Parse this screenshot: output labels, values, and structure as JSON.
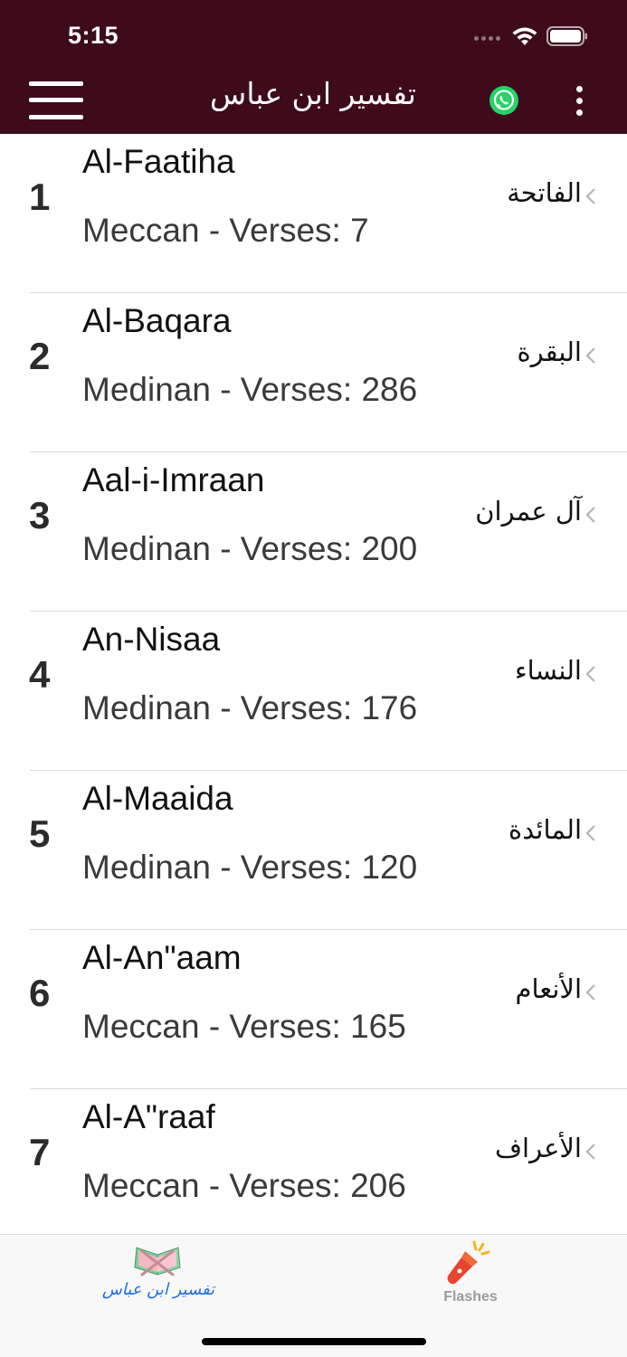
{
  "status_bar": {
    "time": "5:15"
  },
  "nav": {
    "title": "تفسیر ابن عباس"
  },
  "surahs": [
    {
      "number": "1",
      "name": "Al-Faatiha",
      "info": "Meccan - Verses: 7",
      "arabic": "الفاتحة"
    },
    {
      "number": "2",
      "name": "Al-Baqara",
      "info": "Medinan - Verses: 286",
      "arabic": "البقرة"
    },
    {
      "number": "3",
      "name": "Aal-i-Imraan",
      "info": "Medinan - Verses: 200",
      "arabic": "آل عمران"
    },
    {
      "number": "4",
      "name": "An-Nisaa",
      "info": "Medinan - Verses: 176",
      "arabic": "النساء"
    },
    {
      "number": "5",
      "name": "Al-Maaida",
      "info": "Medinan - Verses: 120",
      "arabic": "المائدة"
    },
    {
      "number": "6",
      "name": "Al-An\"aam",
      "info": "Meccan - Verses: 165",
      "arabic": "الأنعام"
    },
    {
      "number": "7",
      "name": "Al-A\"raaf",
      "info": "Meccan - Verses: 206",
      "arabic": "الأعراف"
    }
  ],
  "tabbar": {
    "tafsir_label": "تفسیر ابن عباس",
    "flashes_label": "Flashes"
  },
  "colors": {
    "header_bg": "#3e0b1a",
    "tab_active": "#1e6fe0",
    "tab_inactive": "#9a9a9a",
    "whatsapp": "#25d366"
  }
}
